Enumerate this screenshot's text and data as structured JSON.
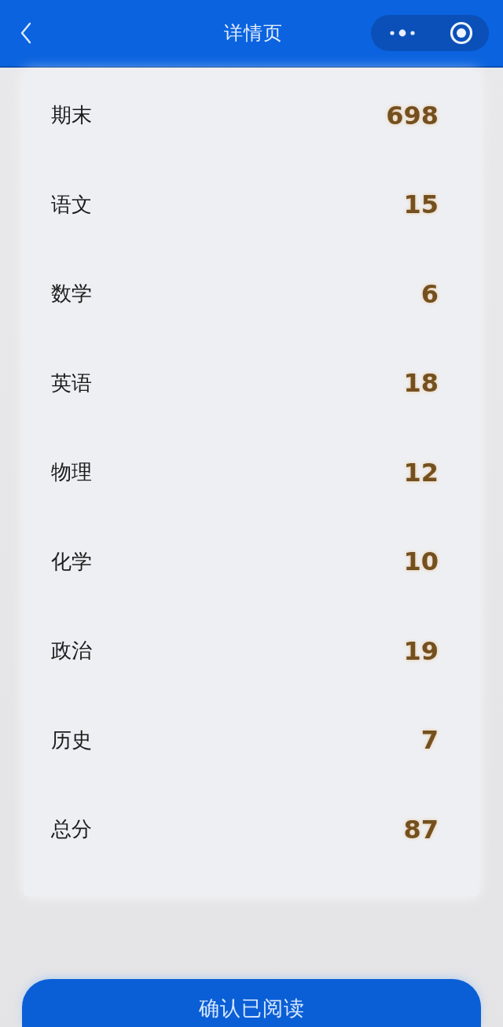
{
  "header": {
    "title": "详情页"
  },
  "scores": [
    {
      "subject": "期末",
      "score": "698"
    },
    {
      "subject": "语文",
      "score": "15"
    },
    {
      "subject": "数学",
      "score": "6"
    },
    {
      "subject": "英语",
      "score": "18"
    },
    {
      "subject": "物理",
      "score": "12"
    },
    {
      "subject": "化学",
      "score": "10"
    },
    {
      "subject": "政治",
      "score": "19"
    },
    {
      "subject": "历史",
      "score": "7"
    },
    {
      "subject": "总分",
      "score": "87"
    }
  ],
  "confirm_button": {
    "label": "确认已阅读"
  }
}
